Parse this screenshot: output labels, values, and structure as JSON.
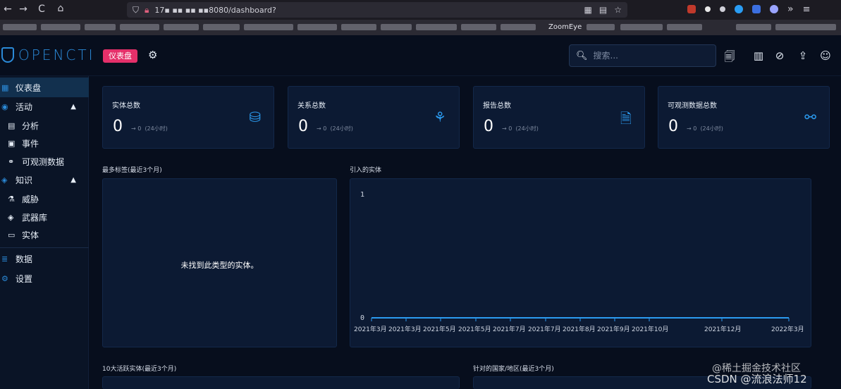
{
  "browser": {
    "nav_back": "←",
    "nav_forward": "→",
    "nav_reload": "C",
    "nav_home": "⌂",
    "url": "17▪ ▪▪ ▪▪ ▪▪8080/dashboard?",
    "bookmark_visible": "ZoomEye",
    "menu_more": "»"
  },
  "header": {
    "logo_text": "OPENCTI",
    "page_chip": "仪表盘",
    "search_placeholder": "搜索...",
    "icons": [
      "gear-icon",
      "search-doc-icon",
      "chart-icon",
      "compass-icon",
      "upload-icon",
      "user-icon"
    ]
  },
  "sidebar": {
    "items": [
      {
        "label": "仪表盘",
        "icon": "dashboard-icon",
        "active": true
      },
      {
        "label": "活动",
        "icon": "activity-icon",
        "expanded": true
      },
      {
        "label": "分析",
        "icon": "analysis-icon",
        "sub": true
      },
      {
        "label": "事件",
        "icon": "event-icon",
        "sub": true
      },
      {
        "label": "可观测数据",
        "icon": "binoculars-icon",
        "sub": true
      },
      {
        "label": "知识",
        "icon": "knowledge-icon",
        "expanded": true
      },
      {
        "label": "威胁",
        "icon": "flask-icon",
        "sub": true
      },
      {
        "label": "武器库",
        "icon": "layers-icon",
        "sub": true
      },
      {
        "label": "实体",
        "icon": "folder-icon",
        "sub": true
      },
      {
        "label": "数据",
        "icon": "database-icon"
      },
      {
        "label": "设置",
        "icon": "settings-icon"
      }
    ]
  },
  "stats": [
    {
      "title": "实体总数",
      "value": "0",
      "delta": "→ 0",
      "period": "(24小时)",
      "icon": "database-icon"
    },
    {
      "title": "关系总数",
      "value": "0",
      "delta": "→ 0",
      "period": "(24小时)",
      "icon": "graph-icon"
    },
    {
      "title": "报告总数",
      "value": "0",
      "delta": "→ 0",
      "period": "(24小时)",
      "icon": "file-icon"
    },
    {
      "title": "可观测数据总数",
      "value": "0",
      "delta": "→ 0",
      "period": "(24小时)",
      "icon": "nodes-icon"
    }
  ],
  "panels": {
    "top_labels": {
      "title": "最多标签(最近3个月)",
      "empty_message": "未找到此类型的实体。"
    },
    "ingested": {
      "title": "引入的实体"
    },
    "active_entities": {
      "title": "10大活跃实体(最近3个月)"
    },
    "targeted_countries": {
      "title": "针对的国家/地区(最近3个月)"
    }
  },
  "chart_data": {
    "type": "area",
    "title": "引入的实体",
    "x": [
      "2021年3月",
      "2021年3月",
      "2021年5月",
      "2021年5月",
      "2021年7月",
      "2021年7月",
      "2021年8月",
      "2021年9月",
      "2021年10月",
      "2021年12月",
      "2022年3月"
    ],
    "series": [
      {
        "values": [
          0,
          0,
          0,
          0,
          0,
          0,
          0,
          0,
          0,
          0,
          0
        ]
      }
    ],
    "y_ticks": [
      "1",
      "0"
    ],
    "ylim": [
      0,
      1
    ],
    "grid": false,
    "color": "#2b9bf0"
  },
  "watermark": {
    "line1": "@稀土掘金技术社区",
    "line2": "CSDN @流浪法师12"
  },
  "colors": {
    "accent": "#2b8ad8",
    "chip": "#e5306a",
    "card_bg": "#0c1a33",
    "page_bg": "#070e1d"
  }
}
